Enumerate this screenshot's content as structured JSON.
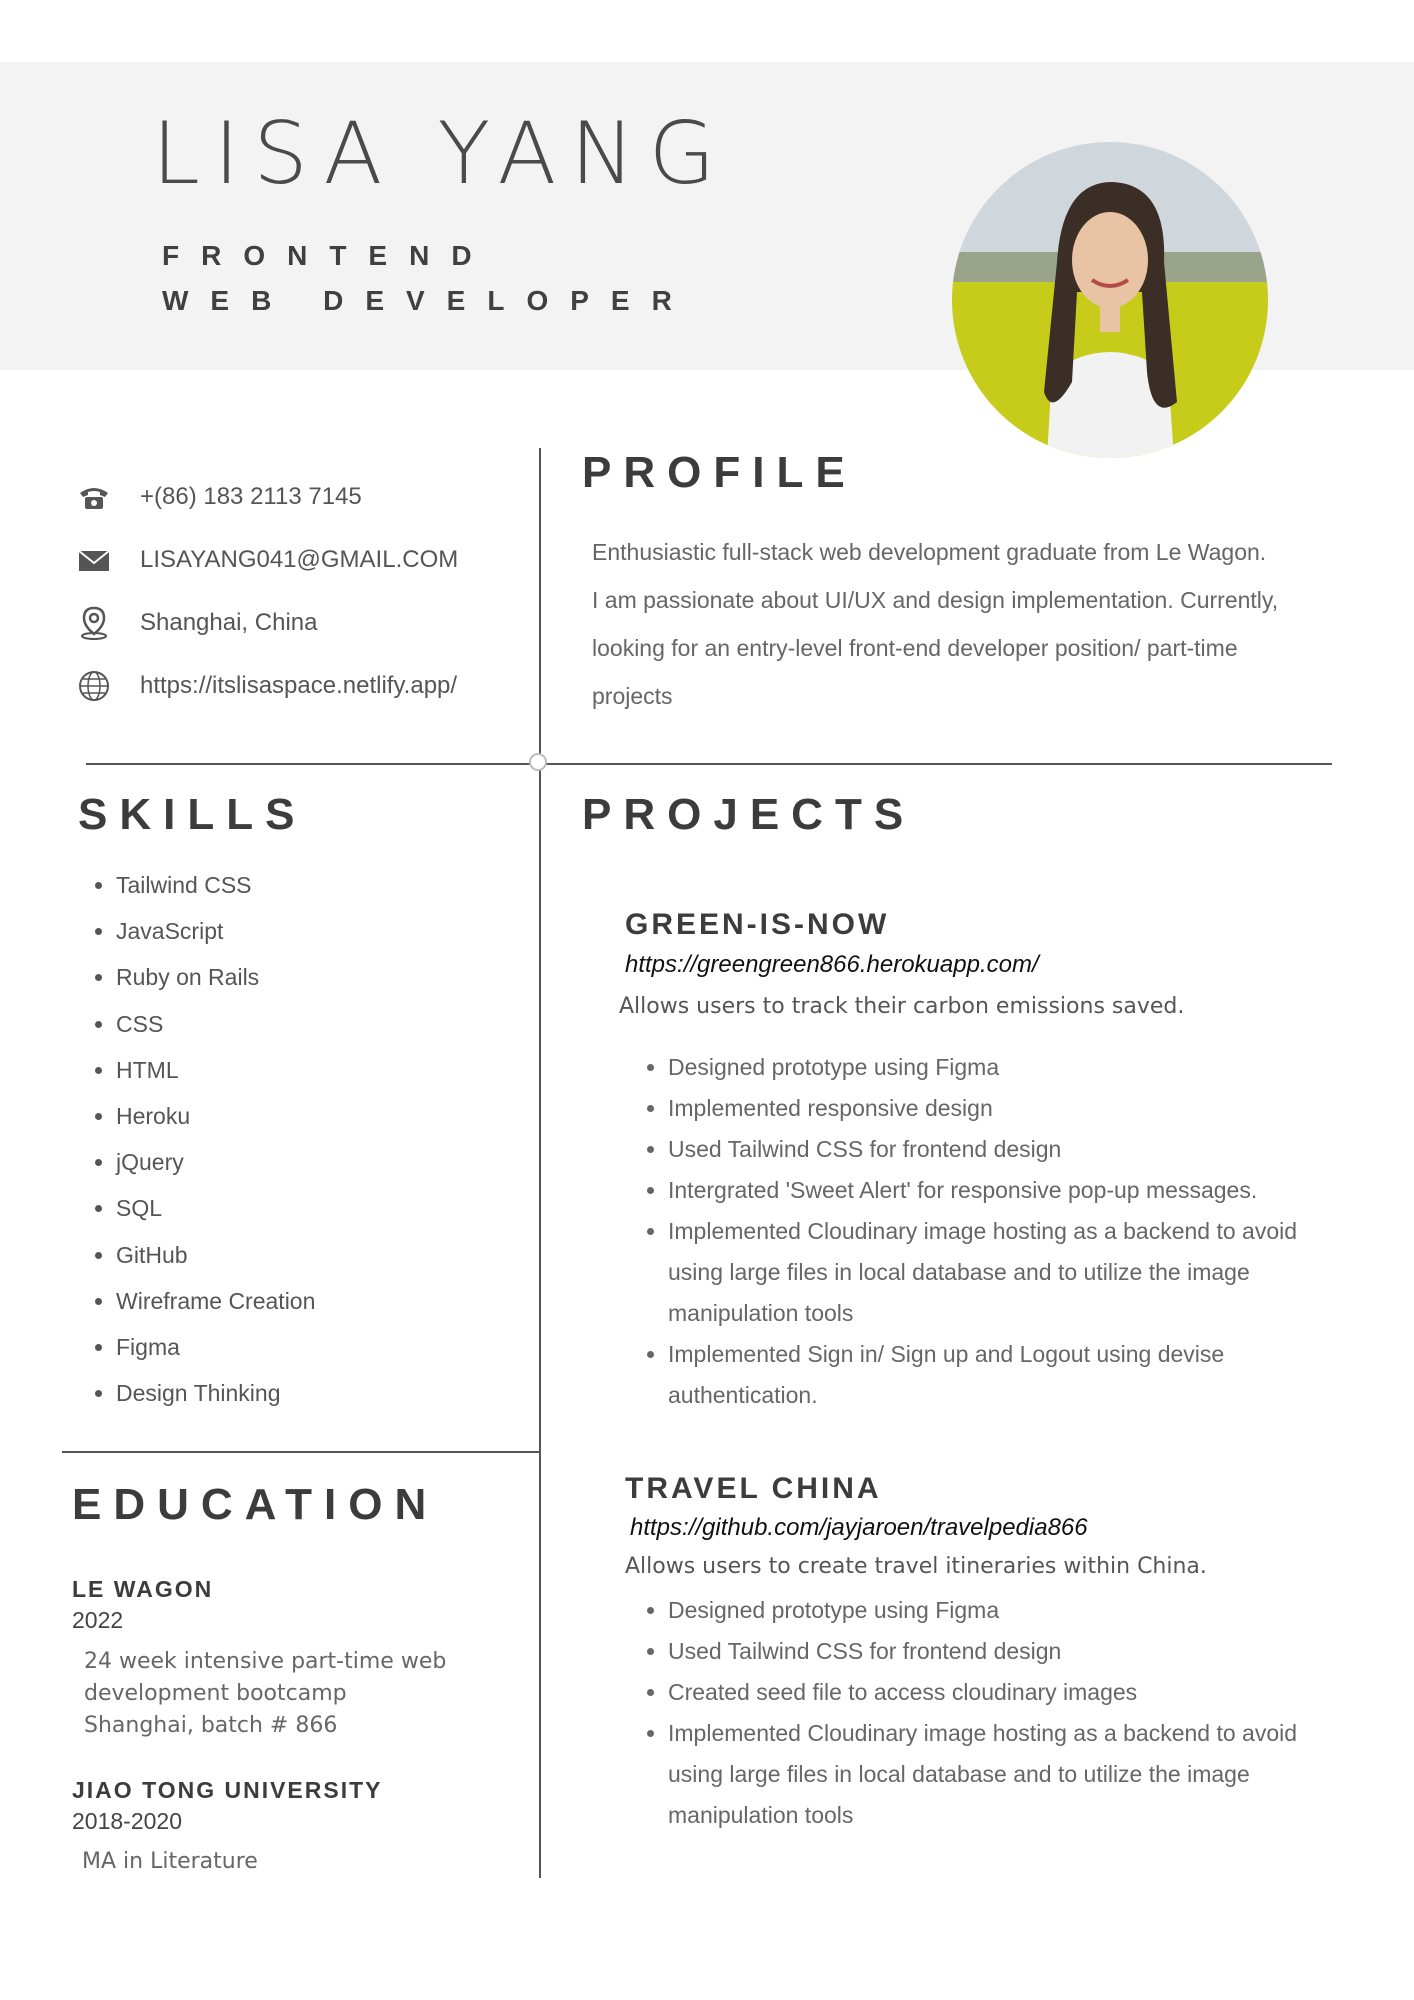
{
  "header": {
    "name": "LISA YANG",
    "role_line1": "FRONTEND",
    "role_line2": "WEB DEVELOPER"
  },
  "contact": [
    {
      "icon": "phone-icon",
      "text": "+(86) 183 2113 7145"
    },
    {
      "icon": "email-icon",
      "text": "LISAYANG041@GMAIL.COM"
    },
    {
      "icon": "location-icon",
      "text": "Shanghai, China"
    },
    {
      "icon": "globe-icon",
      "text": "https://itslisaspace.netlify.app/"
    }
  ],
  "profile": {
    "heading": "PROFILE",
    "lines": [
      "Enthusiastic full-stack web development graduate from Le Wagon.",
      "I am passionate about UI/UX  and design implementation. Currently,",
      "looking for an entry-level front-end developer position/ part-time",
      "projects"
    ]
  },
  "skills": {
    "heading": "SKILLS",
    "items": [
      "Tailwind CSS",
      "JavaScript",
      "Ruby on Rails",
      "CSS",
      "HTML",
      "Heroku",
      "jQuery",
      "SQL",
      "GitHub",
      "Wireframe Creation",
      "Figma",
      "Design Thinking"
    ]
  },
  "education": {
    "heading": "EDUCATION",
    "entries": [
      {
        "school": "LE WAGON",
        "year": "2022",
        "desc": [
          "24 week intensive part-time  web",
          "development bootcamp",
          "Shanghai, batch # 866"
        ]
      },
      {
        "school": "JIAO TONG UNIVERSITY",
        "year": "2018-2020",
        "desc": [
          "MA in Literature"
        ]
      }
    ]
  },
  "projects": {
    "heading": "PROJECTS",
    "items": [
      {
        "title": "GREEN-IS-NOW",
        "link": "https://greengreen866.herokuapp.com/",
        "desc": "Allows users to track their carbon emissions saved.",
        "bullets": [
          "Designed prototype using Figma",
          "Implemented responsive design",
          "Used Tailwind CSS for frontend design",
          "Intergrated 'Sweet Alert' for responsive pop-up messages.",
          "Implemented Cloudinary image hosting as a backend to avoid using large files in local database and to utilize the image manipulation tools",
          "Implemented Sign in/ Sign up and Logout using devise authentication."
        ]
      },
      {
        "title": "TRAVEL CHINA",
        "link": "https://github.com/jayjaroen/travelpedia866",
        "desc": "Allows users to create travel itineraries within China.",
        "bullets": [
          "Designed prototype using Figma",
          "Used Tailwind CSS for frontend design",
          "Created seed file to access cloudinary images",
          "Implemented Cloudinary image hosting as a backend to avoid using large files in local database and to utilize the image manipulation tools"
        ]
      }
    ]
  },
  "colors": {
    "band": "#f3f3f3",
    "text": "#555555",
    "heading": "#3c3c3c"
  }
}
